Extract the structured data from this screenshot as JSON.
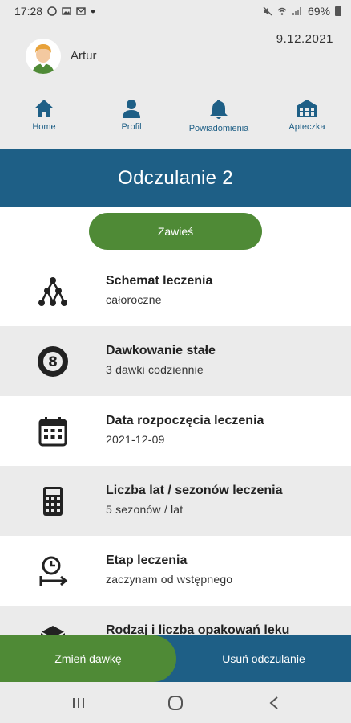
{
  "status_bar": {
    "time": "17:28",
    "battery": "69%"
  },
  "header": {
    "user_name": "Artur",
    "date": "9.12.2021"
  },
  "nav": {
    "items": [
      {
        "label": "Home",
        "icon": "home-icon"
      },
      {
        "label": "Profil",
        "icon": "person-icon"
      },
      {
        "label": "Powiadomienia",
        "icon": "bell-icon"
      },
      {
        "label": "Apteczka",
        "icon": "pharmacy-icon"
      }
    ]
  },
  "page": {
    "title": "Odczulanie 2",
    "suspend_label": "Zawieś"
  },
  "details": [
    {
      "title": "Schemat leczenia",
      "value": "całoroczne",
      "icon": "network-icon"
    },
    {
      "title": "Dawkowanie stałe",
      "value": "3 dawki codziennie",
      "icon": "number-eight-icon"
    },
    {
      "title": "Data rozpoczęcia leczenia",
      "value": "2021-12-09",
      "icon": "calendar-icon"
    },
    {
      "title": "Liczba lat / sezonów leczenia",
      "value": "5 sezonów / lat",
      "icon": "calculator-icon"
    },
    {
      "title": "Etap leczenia",
      "value": "zaczynam od wstępnego",
      "icon": "clock-arrow-icon"
    },
    {
      "title": "Rodzaj i liczba opakowań leku",
      "value": "",
      "icon": "package-icon"
    }
  ],
  "actions": {
    "change_label": "Zmień dawkę",
    "delete_label": "Usuń odczulanie"
  },
  "colors": {
    "primary_blue": "#1e5f86",
    "accent_green": "#4f8a36",
    "header_gray": "#ebebeb"
  }
}
